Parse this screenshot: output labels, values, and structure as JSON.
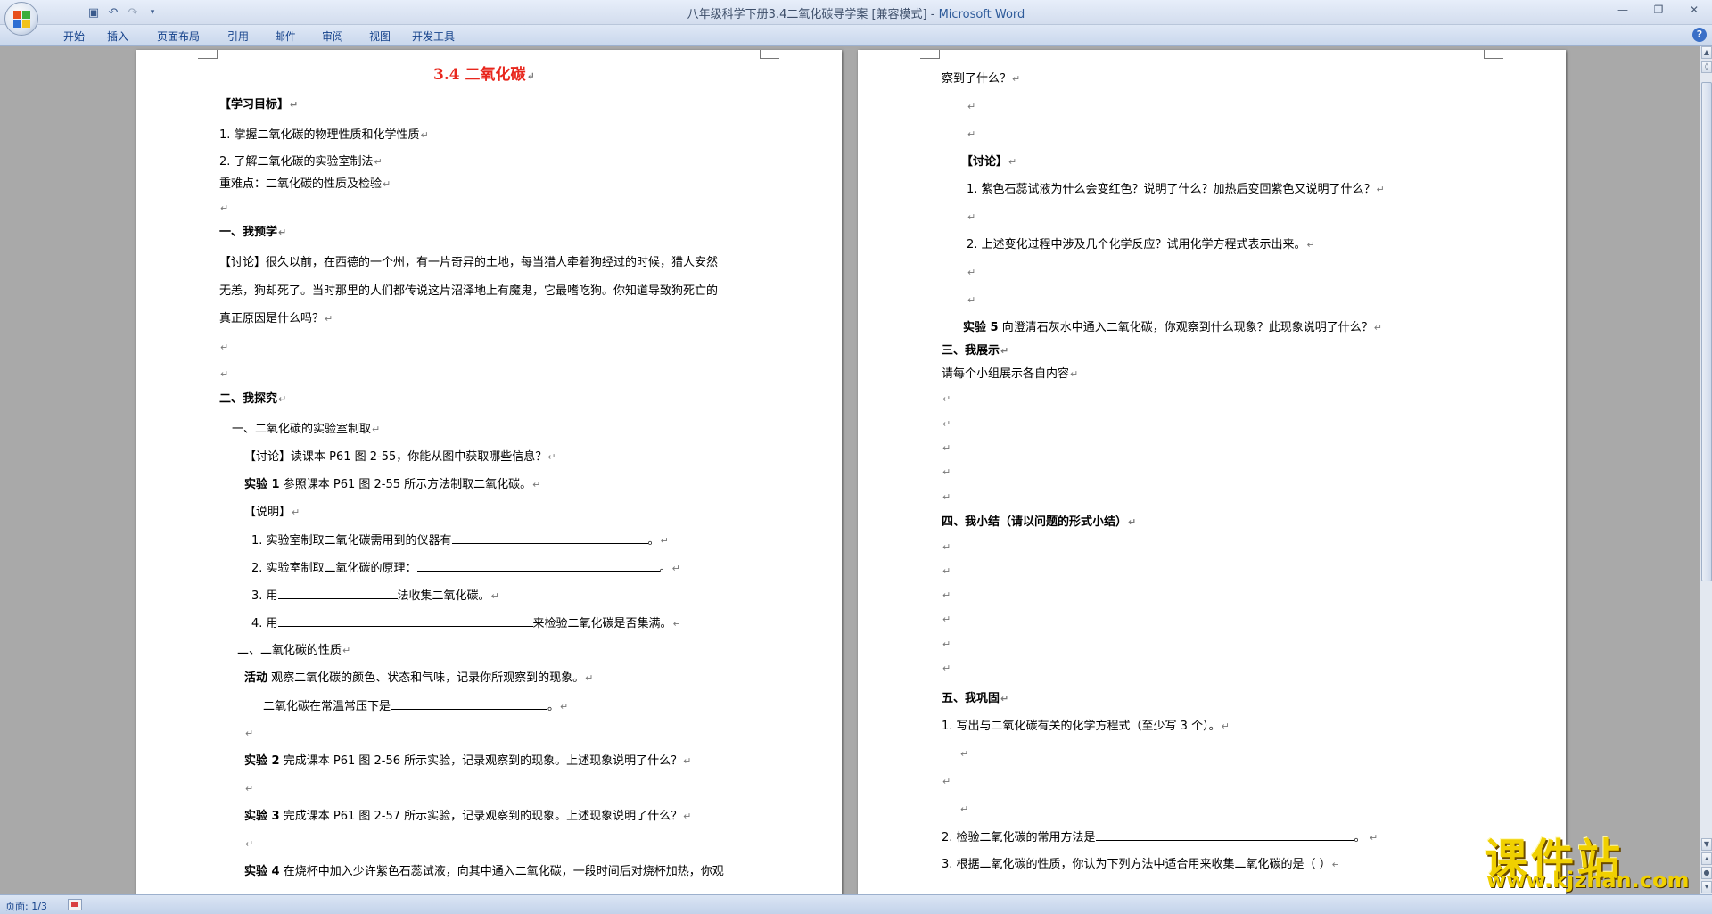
{
  "window": {
    "title": "八年级科学下册3.4二氧化碳导学案 [兼容模式]",
    "app_name": "Microsoft Word",
    "title_sep": " - "
  },
  "ribbon": {
    "tabs": [
      "开始",
      "插入",
      "页面布局",
      "引用",
      "邮件",
      "审阅",
      "视图",
      "开发工具"
    ]
  },
  "statusbar": {
    "page": "页面: 1/3"
  },
  "watermark": {
    "title": "课件站",
    "url": "www.kjzhan.com"
  },
  "page1": {
    "title": "3.4  二氧化碳",
    "goals_heading": "【学习目标】",
    "goal1": "1. 掌握二氧化碳的物理性质和化学性质",
    "goal2": "2. 了解二氧化碳的实验室制法",
    "key_points": "重难点：二氧化碳的性质及检验",
    "sec1": "一、我预学",
    "disc1_a": "【讨论】很久以前，在西德的一个州，有一片奇异的土地，每当猎人牵着狗经过的时候，猎人安然",
    "disc1_b": "无恙，狗却死了。当时那里的人们都传说这片沼泽地上有魔鬼，它最嗜吃狗。你知道导致狗死亡的",
    "disc1_c": "真正原因是什么吗？",
    "sec2": "二、我探究",
    "sub1": "一、二氧化碳的实验室制取",
    "disc2": "【讨论】读课本 P61 图 2-55，你能从图中获取哪些信息？",
    "exp1_label": "实验 1",
    "exp1_text": "参照课本 P61 图 2-55 所示方法制取二氧化碳。",
    "note_heading": "【说明】",
    "q1_a": "1. 实验室制取二氧化碳需用到的仪器有",
    "q1_b": "。",
    "q2_a": "2. 实验室制取二氧化碳的原理：",
    "q2_b": "。",
    "q3_a": "3. 用",
    "q3_b": "法收集二氧化碳。",
    "q4_a": "4. 用",
    "q4_b": "来检验二氧化碳是否集满。",
    "sub2": "二、二氧化碳的性质",
    "act_label": "活动",
    "act_text": "观察二氧化碳的颜色、状态和气味，记录你所观察到的现象。",
    "state_a": "二氧化碳在常温常压下是",
    "state_b": "。",
    "exp2_label": "实验 2",
    "exp2_text": "完成课本 P61 图 2-56 所示实验，记录观察到的现象。上述现象说明了什么？",
    "exp3_label": "实验 3",
    "exp3_text": "完成课本 P61 图 2-57 所示实验，记录观察到的现象。上述现象说明了什么？",
    "exp4_label": "实验 4",
    "exp4_text": "在烧杯中加入少许紫色石蕊试液，向其中通入二氧化碳，一段时间后对烧杯加热，你观"
  },
  "page2": {
    "cont": "察到了什么？",
    "disc_heading": "【讨论】",
    "d1": "1. 紫色石蕊试液为什么会变红色？说明了什么？加热后变回紫色又说明了什么？",
    "d2": "2. 上述变化过程中涉及几个化学反应？试用化学方程式表示出来。",
    "exp5_label": "实验 5",
    "exp5_text": "向澄清石灰水中通入二氧化碳，你观察到什么现象？此现象说明了什么？",
    "sec3": "三、我展示",
    "show_text": "请每个小组展示各自内容",
    "sec4": "四、我小结（请以问题的形式小结）",
    "sec5": "五、我巩固",
    "c1": "1. 写出与二氧化碳有关的化学方程式（至少写 3 个）。",
    "c2_a": "2. 检验二氧化碳的常用方法是",
    "c2_b": "。",
    "c3": "3. 根据二氧化碳的性质，你认为下列方法中适合用来收集二氧化碳的是（    ）"
  },
  "colors": {
    "title_red": "#e8261c",
    "ribbon_text": "#15428b",
    "watermark_yellow": "#f0d000"
  }
}
